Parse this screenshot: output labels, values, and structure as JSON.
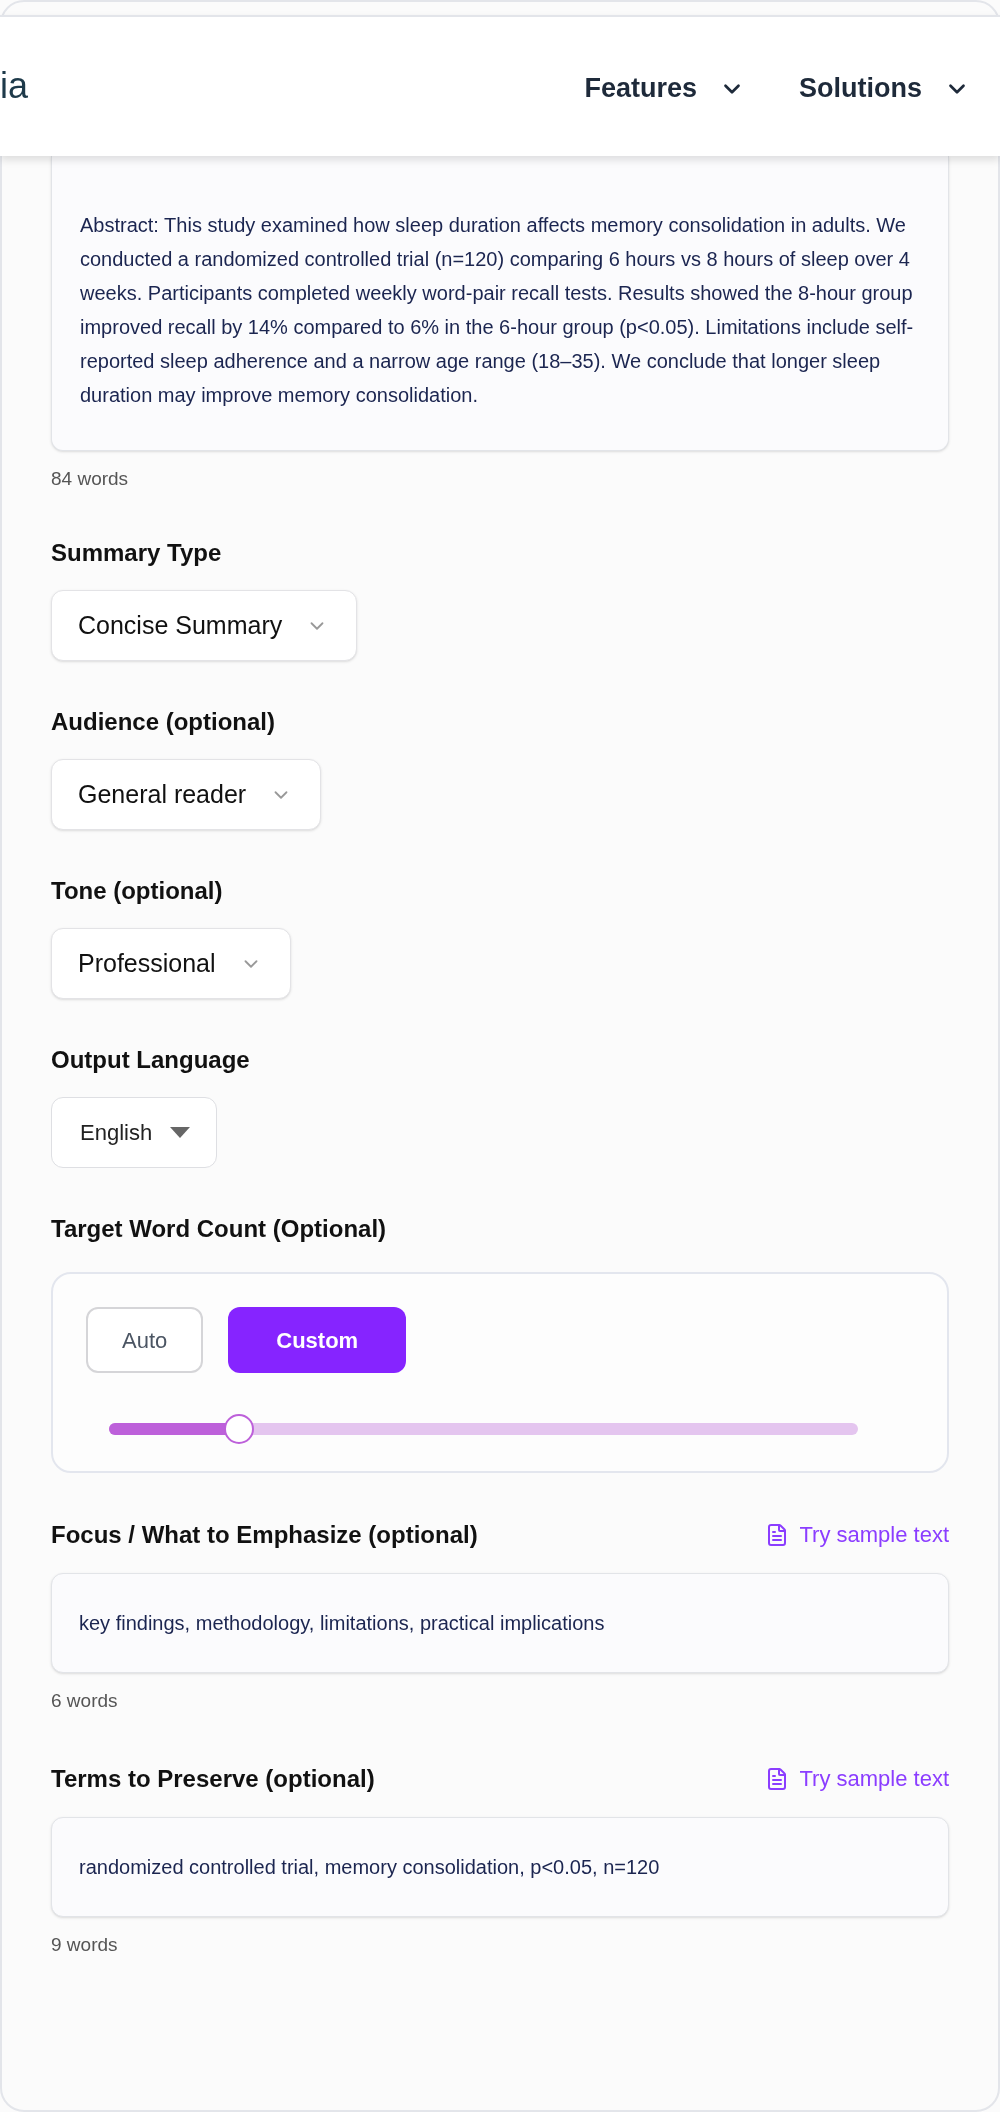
{
  "header": {
    "logo": "ia",
    "nav": [
      {
        "label": "Features"
      },
      {
        "label": "Solutions"
      }
    ]
  },
  "source_text": {
    "value": "Abstract: This study examined how sleep duration affects memory consolidation in adults. We conducted a randomized controlled trial (n=120) comparing 6 hours vs 8 hours of sleep over 4 weeks. Participants completed weekly word-pair recall tests. Results showed the 8-hour group improved recall by 14% compared to 6% in the 6-hour group (p<0.05). Limitations include self-reported sleep adherence and a narrow age range (18–35). We conclude that longer sleep duration may improve memory consolidation.",
    "word_count": "84 words"
  },
  "selects": [
    {
      "label": "Summary Type",
      "value": "Concise Summary",
      "kind": "chevron"
    },
    {
      "label": "Audience (optional)",
      "value": "General reader",
      "kind": "chevron"
    },
    {
      "label": "Tone (optional)",
      "value": "Professional",
      "kind": "chevron"
    },
    {
      "label": "Output Language",
      "value": "English",
      "kind": "native"
    }
  ],
  "target_word_count": {
    "label": "Target Word Count (Optional)",
    "modes": [
      {
        "label": "Auto",
        "selected": false
      },
      {
        "label": "Custom",
        "selected": true
      }
    ],
    "slider": {
      "level": 0.174
    }
  },
  "text_fields": [
    {
      "label": "Focus / What to Emphasize (optional)",
      "link": "Try sample text",
      "value": "key findings, methodology, limitations, practical implications",
      "word_count": "6 words"
    },
    {
      "label": "Terms to Preserve (optional)",
      "link": "Try sample text",
      "value": "randomized controlled trial, memory consolidation, p<0.05, n=120",
      "word_count": "9 words"
    }
  ]
}
